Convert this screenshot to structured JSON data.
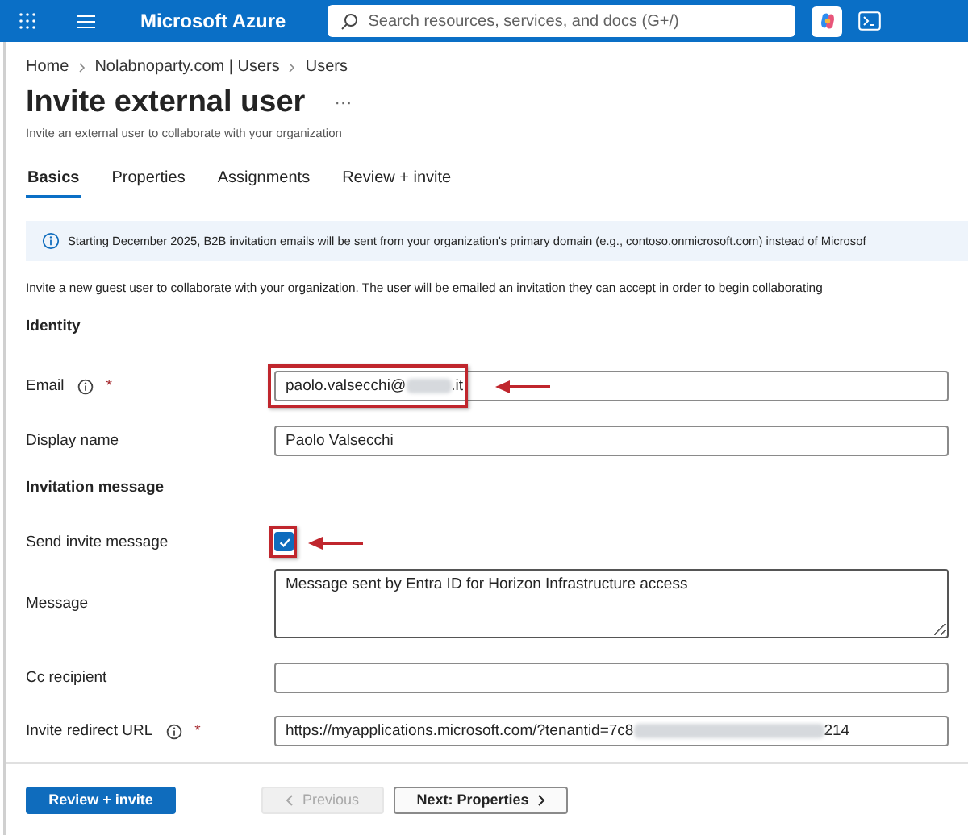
{
  "top_bar": {
    "title": "Microsoft Azure",
    "search": {
      "placeholder": "Search resources, services, and docs (G+/)"
    }
  },
  "breadcrumb": [
    "Home",
    "Nolabnoparty.com | Users",
    "Users"
  ],
  "page": {
    "title": "Invite external user",
    "more": "···",
    "subtitle": "Invite an external user to collaborate with your organization"
  },
  "tabs": [
    {
      "label": "Basics",
      "selected": true
    },
    {
      "label": "Properties",
      "selected": false
    },
    {
      "label": "Assignments",
      "selected": false
    },
    {
      "label": "Review + invite",
      "selected": false
    }
  ],
  "info_banner": "Starting December 2025, B2B invitation emails will be sent from your organization's primary domain (e.g., contoso.onmicrosoft.com) instead of Microsof",
  "intro": "Invite a new guest user to collaborate with your organization. The user will be emailed an invitation they can accept in order to begin collaborating",
  "sections": [
    {
      "heading": "Identity",
      "fields": [
        {
          "kind": "text",
          "label": "Email",
          "info": true,
          "required_mark": "*",
          "value": "paolo.valsecchi@",
          "value_end": ".it",
          "redacted": true,
          "annotated": true
        },
        {
          "kind": "text",
          "label": "Display name",
          "value": "Paolo Valsecchi"
        }
      ]
    },
    {
      "heading": "Invitation message",
      "fields": [
        {
          "kind": "checkbox",
          "label": "Send invite message",
          "checked": true,
          "annotated": true
        },
        {
          "kind": "textarea",
          "label": "Message",
          "value": "Message sent by Entra ID for Horizon Infrastructure access"
        },
        {
          "kind": "text",
          "label": "Cc recipient"
        },
        {
          "kind": "text",
          "label": "Invite redirect URL",
          "info": true,
          "required_mark": "*",
          "value": "https://myapplications.microsoft.com/?tenantid=7c8",
          "value_end": "214",
          "redacted": true
        }
      ]
    }
  ],
  "footer": [
    {
      "label": "Review + invite",
      "kind": "primary",
      "disabled": false
    },
    {
      "label": "Previous",
      "kind": "back",
      "disabled": true
    },
    {
      "label": "Next: Properties",
      "kind": "next",
      "disabled": false
    }
  ]
}
